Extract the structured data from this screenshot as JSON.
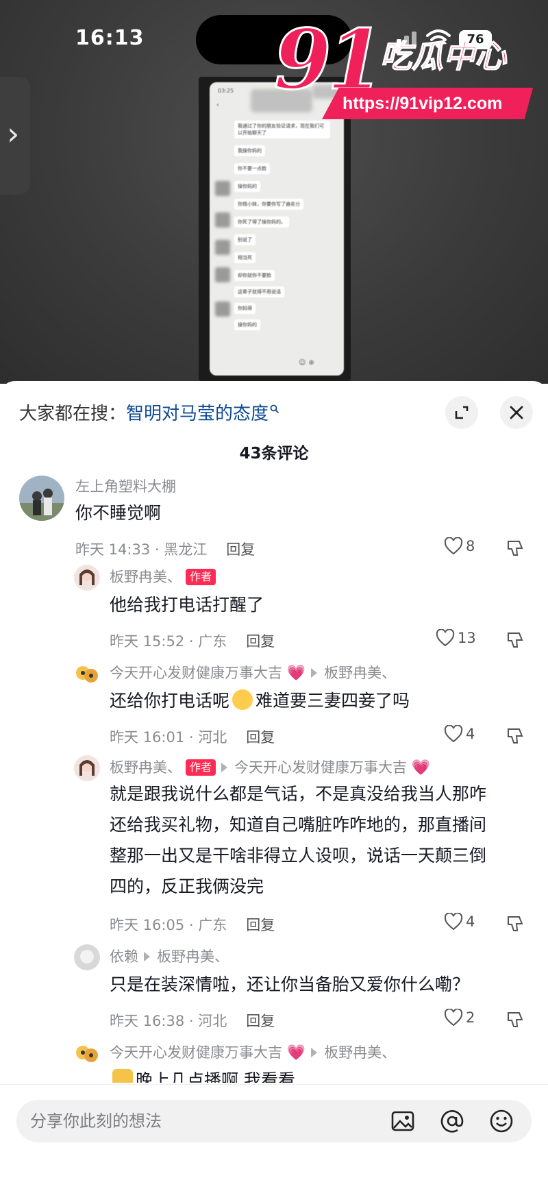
{
  "status_bar": {
    "time": "16:13",
    "battery": "76"
  },
  "photo": {
    "clock": "03:25",
    "messages": [
      "我通过了你的朋友验证请求，现在我们可以开始聊天了",
      "我操你妈的",
      "你不要一点脸",
      "操你妈的",
      "你贱小妹，你要你写了遍名分",
      "你死了得了操你妈的。",
      "别说了",
      "相当死",
      "却你就你不要脸",
      "这辈子就得不用说话",
      "你妈得",
      "操你妈的"
    ]
  },
  "watermark": {
    "number": "91",
    "brand": "吃瓜中心",
    "url": "https://91vip12.com"
  },
  "sheet": {
    "search_prefix": "大家都在搜：",
    "search_term": "智明对马莹的态度",
    "comment_count": "43条评论"
  },
  "comments": [
    {
      "name": "左上角塑料大棚",
      "text": "你不睡觉啊",
      "time": "昨天 14:33 · 黑龙江",
      "reply": "回复",
      "likes": "8"
    },
    {
      "name": "板野冉美、",
      "tag": "作者",
      "text": "他给我打电话打醒了",
      "time": "昨天 15:52 · 广东",
      "reply": "回复",
      "likes": "13"
    },
    {
      "name": "今天开心发财健康万事大吉",
      "reply_to": "板野冉美、",
      "text_a": "还给你打电话呢",
      "text_b": "难道要三妻四妾了吗",
      "time": "昨天 16:01 · 河北",
      "reply": "回复",
      "likes": "4"
    },
    {
      "name": "板野冉美、",
      "tag": "作者",
      "reply_to": "今天开心发财健康万事大吉",
      "lines": [
        "就是跟我说什么都是气话，不是真没给我当人那咋",
        "还给我买礼物，知道自己嘴脏咋咋地的，那直播间",
        "整那一出又是干啥非得立人设呗，说话一天颠三倒",
        "四的，反正我俩没完"
      ],
      "time": "昨天 16:05 · 广东",
      "reply": "回复",
      "likes": "4"
    },
    {
      "name": "依赖",
      "reply_to": "板野冉美、",
      "text": "只是在装深情啦，还让你当备胎又爱你什么嘞？",
      "time": "昨天 16:38 · 河北",
      "reply": "回复",
      "likes": "2"
    },
    {
      "name": "今天开心发财健康万事大吉",
      "reply_to": "板野冉美、",
      "text": "晚上几点播啊 我看看"
    }
  ],
  "input": {
    "placeholder": "分享你此刻的想法"
  },
  "colors": {
    "accent": "#fe2c55",
    "link": "#0d4a94",
    "watermark": "#f0215a"
  }
}
